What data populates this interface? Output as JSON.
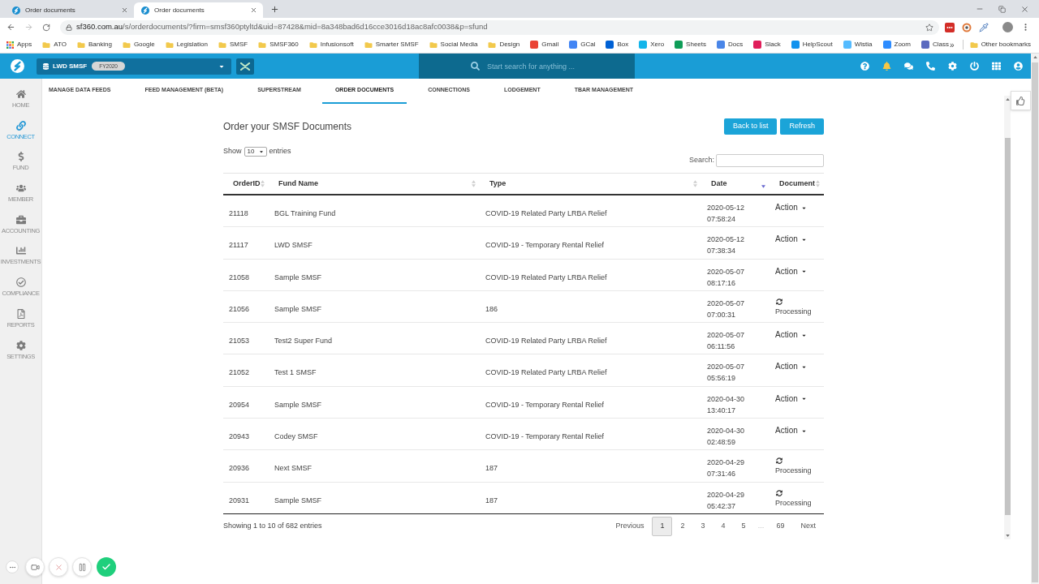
{
  "browser": {
    "tabs": [
      {
        "title": "Order documents",
        "selected": false
      },
      {
        "title": "Order documents",
        "selected": true
      }
    ],
    "address": {
      "host": "sf360.com.au",
      "path": "/s/orderdocuments/?firm=smsf360ptyltd&uid=87428&mid=8a348bad6d16cce3016d18ac8afc0038&p=sfund"
    },
    "bookmarks": [
      {
        "label": "Apps",
        "kind": "apps"
      },
      {
        "label": "ATO",
        "kind": "folder"
      },
      {
        "label": "Banking",
        "kind": "folder"
      },
      {
        "label": "Google",
        "kind": "folder"
      },
      {
        "label": "Legislation",
        "kind": "folder"
      },
      {
        "label": "SMSF",
        "kind": "folder"
      },
      {
        "label": "SMSF360",
        "kind": "folder"
      },
      {
        "label": "Infusionsoft",
        "kind": "folder"
      },
      {
        "label": "Smarter SMSF",
        "kind": "folder"
      },
      {
        "label": "Social Media",
        "kind": "folder"
      },
      {
        "label": "Design",
        "kind": "folder"
      },
      {
        "label": "Gmail",
        "kind": "site",
        "color": "#ea4335"
      },
      {
        "label": "GCal",
        "kind": "site",
        "color": "#4285f4"
      },
      {
        "label": "Box",
        "kind": "site",
        "color": "#0061d5"
      },
      {
        "label": "Xero",
        "kind": "site",
        "color": "#13b5ea"
      },
      {
        "label": "Sheets",
        "kind": "site",
        "color": "#0f9d58"
      },
      {
        "label": "Docs",
        "kind": "site",
        "color": "#4a86e8"
      },
      {
        "label": "Slack",
        "kind": "site",
        "color": "#e01e5a"
      },
      {
        "label": "HelpScout",
        "kind": "site",
        "color": "#1292ee"
      },
      {
        "label": "Wistia",
        "kind": "site",
        "color": "#54bbff"
      },
      {
        "label": "Zoom",
        "kind": "site",
        "color": "#2d8cff"
      },
      {
        "label": "Class",
        "kind": "site",
        "color": "#5b6abf"
      }
    ],
    "overflow": "»",
    "other_bookmarks": "Other bookmarks"
  },
  "app_header": {
    "fund": "LWD SMSF",
    "year": "FY2020",
    "search": {
      "placeholder": "Start search for anything ..."
    }
  },
  "sidebar": {
    "items": [
      {
        "label": "HOME",
        "selected": false
      },
      {
        "label": "CONNECT",
        "selected": true
      },
      {
        "label": "FUND",
        "selected": false
      },
      {
        "label": "MEMBER",
        "selected": false
      },
      {
        "label": "ACCOUNTING",
        "selected": false
      },
      {
        "label": "INVESTMENTS",
        "selected": false
      },
      {
        "label": "COMPLIANCE",
        "selected": false
      },
      {
        "label": "REPORTS",
        "selected": false
      },
      {
        "label": "SETTINGS",
        "selected": false
      }
    ]
  },
  "subnav": {
    "tabs": [
      {
        "label": "MANAGE DATA FEEDS",
        "selected": false
      },
      {
        "label": "FEED MANAGEMENT (BETA)",
        "selected": false
      },
      {
        "label": "SUPERSTREAM",
        "selected": false
      },
      {
        "label": "ORDER DOCUMENTS",
        "selected": true
      },
      {
        "label": "CONNECTIONS",
        "selected": false
      },
      {
        "label": "LODGEMENT",
        "selected": false
      },
      {
        "label": "TBAR MANAGEMENT",
        "selected": false
      }
    ]
  },
  "page": {
    "title": "Order your SMSF Documents",
    "buttons": [
      "Back to list",
      "Refresh"
    ],
    "length": {
      "before": "Show",
      "value": "10",
      "after": "entries"
    },
    "search": {
      "label": "Search:"
    },
    "table": {
      "columns": [
        {
          "label": "OrderID",
          "kind": "sortable"
        },
        {
          "label": "Fund Name",
          "kind": "sortable"
        },
        {
          "label": "Type",
          "kind": "sortable"
        },
        {
          "label": "Date",
          "kind": "descending"
        },
        {
          "label": "Document",
          "kind": "sortable"
        }
      ],
      "rows": [
        {
          "order_id": "21118",
          "fund_name": "BGL Training Fund",
          "type": "COVID-19 Related Party LRBA Relief",
          "date": "2020-05-12 07:58:24",
          "document": {
            "kind": "action",
            "label": "Action"
          }
        },
        {
          "order_id": "21117",
          "fund_name": "LWD SMSF",
          "type": "COVID-19 - Temporary Rental Relief",
          "date": "2020-05-12 07:38:34",
          "document": {
            "kind": "action",
            "label": "Action"
          }
        },
        {
          "order_id": "21058",
          "fund_name": "Sample SMSF",
          "type": "COVID-19 Related Party LRBA Relief",
          "date": "2020-05-07 08:17:16",
          "document": {
            "kind": "action",
            "label": "Action"
          }
        },
        {
          "order_id": "21056",
          "fund_name": "Sample SMSF",
          "type": "186",
          "date": "2020-05-07 07:00:31",
          "document": {
            "kind": "processing",
            "label": "Processing"
          }
        },
        {
          "order_id": "21053",
          "fund_name": "Test2 Super Fund",
          "type": "COVID-19 Related Party LRBA Relief",
          "date": "2020-05-07 06:11:56",
          "document": {
            "kind": "action",
            "label": "Action"
          }
        },
        {
          "order_id": "21052",
          "fund_name": "Test 1 SMSF",
          "type": "COVID-19 Related Party LRBA Relief",
          "date": "2020-05-07 05:56:19",
          "document": {
            "kind": "action",
            "label": "Action"
          }
        },
        {
          "order_id": "20954",
          "fund_name": "Sample SMSF",
          "type": "COVID-19 - Temporary Rental Relief",
          "date": "2020-04-30 13:40:17",
          "document": {
            "kind": "action",
            "label": "Action"
          }
        },
        {
          "order_id": "20943",
          "fund_name": "Codey SMSF",
          "type": "COVID-19 - Temporary Rental Relief",
          "date": "2020-04-30 02:48:59",
          "document": {
            "kind": "action",
            "label": "Action"
          }
        },
        {
          "order_id": "20936",
          "fund_name": "Next SMSF",
          "type": "187",
          "date": "2020-04-29 07:31:46",
          "document": {
            "kind": "processing",
            "label": "Processing"
          }
        },
        {
          "order_id": "20931",
          "fund_name": "Sample SMSF",
          "type": "187",
          "date": "2020-04-29 05:42:37",
          "document": {
            "kind": "processing",
            "label": "Processing"
          }
        }
      ]
    },
    "info": "Showing 1 to 10 of 682 entries",
    "pagination": {
      "previous": "Previous",
      "pages": [
        {
          "label": "1",
          "kind": "page",
          "selected": true
        },
        {
          "label": "2",
          "kind": "page",
          "selected": false
        },
        {
          "label": "3",
          "kind": "page",
          "selected": false
        },
        {
          "label": "4",
          "kind": "page",
          "selected": false
        },
        {
          "label": "5",
          "kind": "page",
          "selected": false
        },
        {
          "label": "…",
          "kind": "gap",
          "selected": false
        },
        {
          "label": "69",
          "kind": "page",
          "selected": false
        }
      ],
      "next": "Next"
    }
  }
}
